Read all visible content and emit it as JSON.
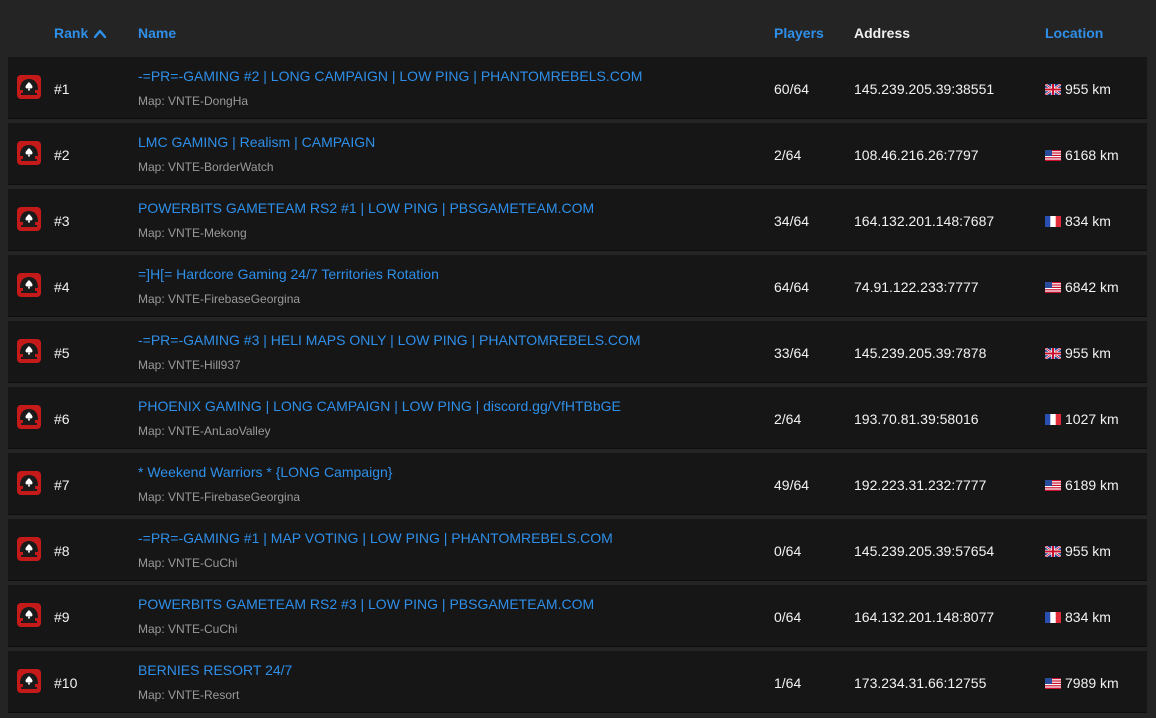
{
  "header": {
    "rank": "Rank",
    "name": "Name",
    "players": "Players",
    "address": "Address",
    "location": "Location"
  },
  "colors": {
    "link": "#2f8fe8",
    "row_background": "#161616",
    "page_background": "#242424",
    "muted_text": "#9a9a9a"
  },
  "rows": [
    {
      "rank": "#1",
      "name": "-=PR=-GAMING #2 | LONG CAMPAIGN | LOW PING | PHANTOMREBELS.COM",
      "map": "Map: VNTE-DongHa",
      "players": "60/64",
      "address": "145.239.205.39:38551",
      "flag": "uk-flag-icon",
      "distance": "955 km"
    },
    {
      "rank": "#2",
      "name": "LMC GAMING | Realism | CAMPAIGN",
      "map": "Map: VNTE-BorderWatch",
      "players": "2/64",
      "address": "108.46.216.26:7797",
      "flag": "us-flag-icon",
      "distance": "6168 km"
    },
    {
      "rank": "#3",
      "name": "POWERBITS GAMETEAM RS2 #1 | LOW PING | PBSGAMETEAM.COM",
      "map": "Map: VNTE-Mekong",
      "players": "34/64",
      "address": "164.132.201.148:7687",
      "flag": "fr-flag-icon",
      "distance": "834 km"
    },
    {
      "rank": "#4",
      "name": "=]H[= Hardcore Gaming 24/7 Territories Rotation",
      "map": "Map: VNTE-FirebaseGeorgina",
      "players": "64/64",
      "address": "74.91.122.233:7777",
      "flag": "us-flag-icon",
      "distance": "6842 km"
    },
    {
      "rank": "#5",
      "name": "-=PR=-GAMING #3 | HELI MAPS ONLY | LOW PING | PHANTOMREBELS.COM",
      "map": "Map: VNTE-Hill937",
      "players": "33/64",
      "address": "145.239.205.39:7878",
      "flag": "uk-flag-icon",
      "distance": "955 km"
    },
    {
      "rank": "#6",
      "name": "PHOENIX GAMING | LONG CAMPAIGN | LOW PING | discord.gg/VfHTBbGE",
      "map": "Map: VNTE-AnLaoValley",
      "players": "2/64",
      "address": "193.70.81.39:58016",
      "flag": "fr-flag-icon",
      "distance": "1027 km"
    },
    {
      "rank": "#7",
      "name": "* Weekend Warriors * {LONG Campaign}",
      "map": "Map: VNTE-FirebaseGeorgina",
      "players": "49/64",
      "address": "192.223.31.232:7777",
      "flag": "us-flag-icon",
      "distance": "6189 km"
    },
    {
      "rank": "#8",
      "name": "-=PR=-GAMING #1 | MAP VOTING | LOW PING | PHANTOMREBELS.COM",
      "map": "Map: VNTE-CuChi",
      "players": "0/64",
      "address": "145.239.205.39:57654",
      "flag": "uk-flag-icon",
      "distance": "955 km"
    },
    {
      "rank": "#9",
      "name": "POWERBITS GAMETEAM RS2 #3 | LOW PING | PBSGAMETEAM.COM",
      "map": "Map: VNTE-CuChi",
      "players": "0/64",
      "address": "164.132.201.148:8077",
      "flag": "fr-flag-icon",
      "distance": "834 km"
    },
    {
      "rank": "#10",
      "name": "BERNIES RESORT 24/7",
      "map": "Map: VNTE-Resort",
      "players": "1/64",
      "address": "173.234.31.66:12755",
      "flag": "us-flag-icon",
      "distance": "7989 km"
    }
  ]
}
